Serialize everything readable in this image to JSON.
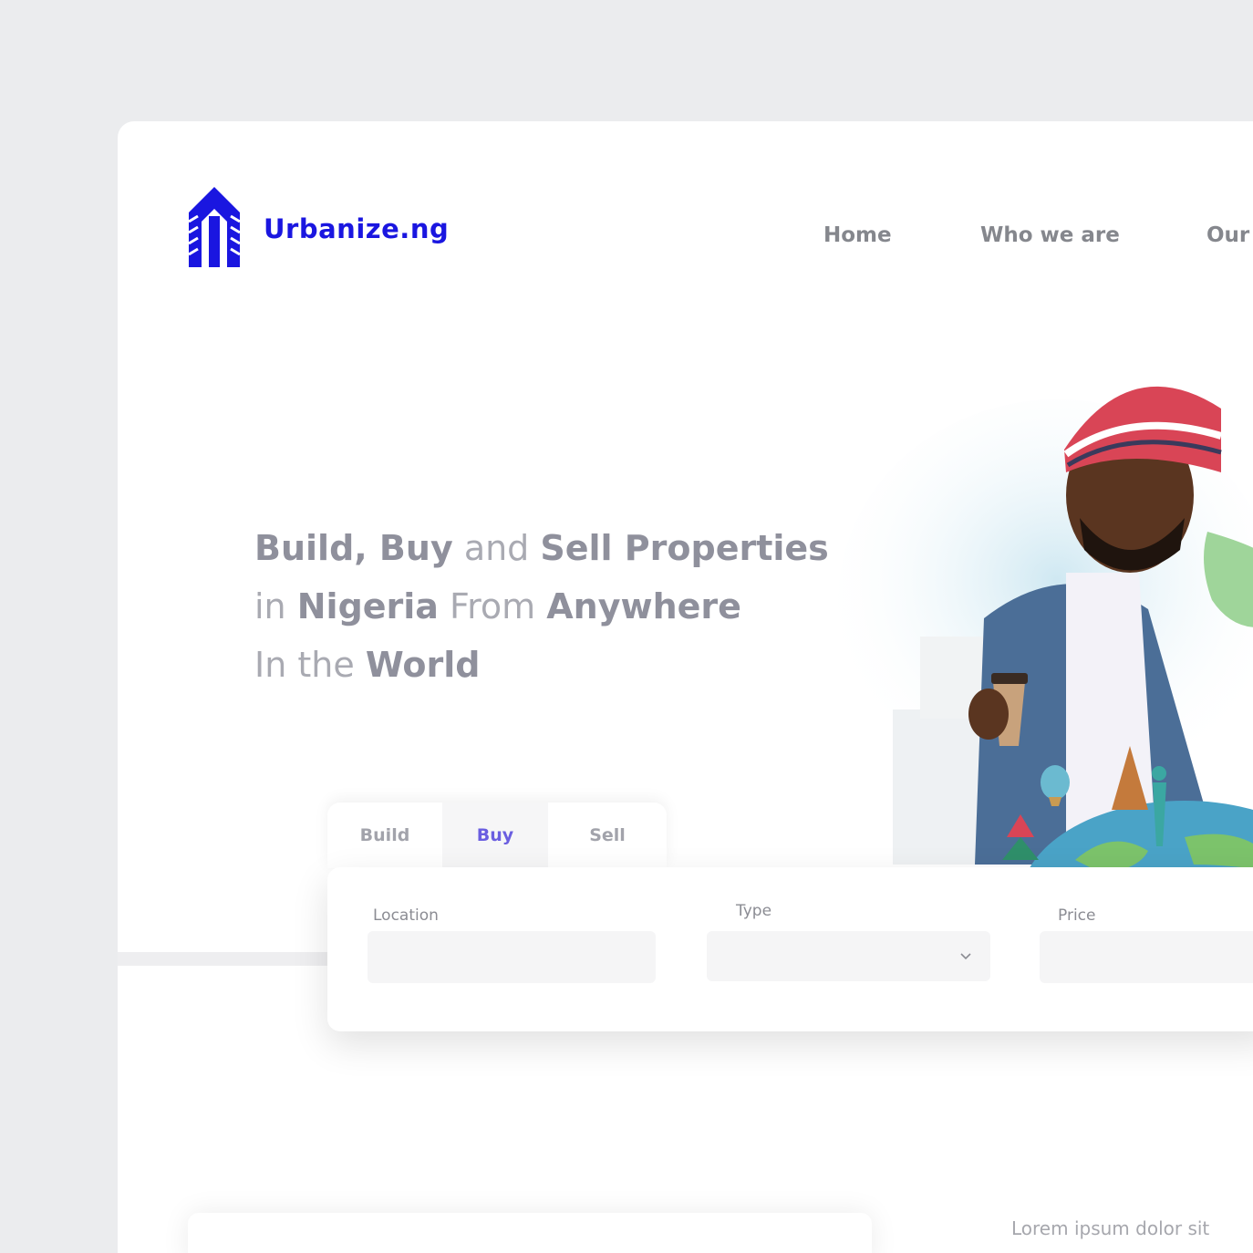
{
  "brand": {
    "name": "Urbanize.ng",
    "logo_icon": "building-icon",
    "color": "#1a16e0"
  },
  "nav": {
    "items": [
      {
        "label": "Home"
      },
      {
        "label": "Who we are"
      },
      {
        "label": "Our"
      }
    ]
  },
  "hero": {
    "line1": {
      "a": "Build, Buy",
      "b": " and ",
      "c": "Sell Properties"
    },
    "line2": {
      "a": "in ",
      "b": "Nigeria",
      "c": " From ",
      "d": "Anywhere"
    },
    "line3": {
      "a": "In the ",
      "b": "World"
    }
  },
  "search": {
    "tabs": [
      {
        "label": "Build"
      },
      {
        "label": "Buy"
      },
      {
        "label": "Sell"
      }
    ],
    "active_tab": "Buy",
    "fields": {
      "location": {
        "label": "Location",
        "value": ""
      },
      "type": {
        "label": "Type",
        "value": ""
      },
      "price": {
        "label": "Price",
        "value": ""
      }
    },
    "accent": "#6a5ee0"
  },
  "footer_preview": {
    "text": "Lorem ipsum dolor sit"
  }
}
